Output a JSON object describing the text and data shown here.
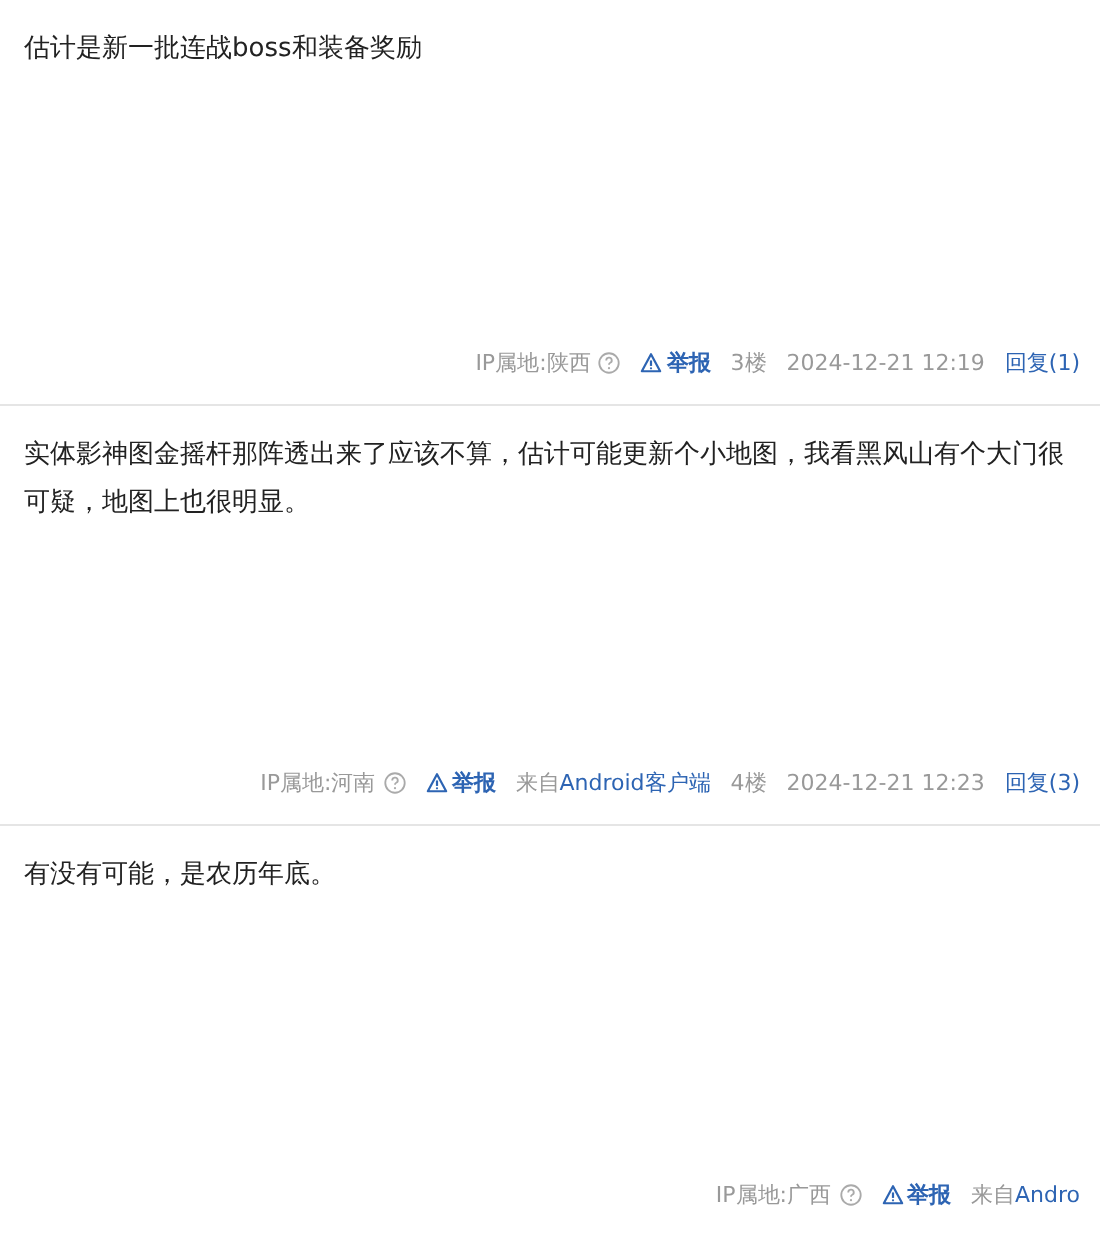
{
  "posts": [
    {
      "content": "估计是新一批连战boss和装备奖励",
      "ip": "IP属地:陕西",
      "report": "举报",
      "floor": "3楼",
      "time": "2024-12-21 12:19",
      "reply": "回复(1)"
    },
    {
      "content": "实体影神图金摇杆那阵透出来了应该不算，估计可能更新个小地图，我看黑风山有个大门很可疑，地图上也很明显。",
      "ip": "IP属地:河南",
      "report": "举报",
      "source_prefix": "来自",
      "source_app": "Android客户端",
      "floor": "4楼",
      "time": "2024-12-21 12:23",
      "reply": "回复(3)"
    },
    {
      "content": "有没有可能，是农历年底。",
      "ip": "IP属地:广西",
      "report": "举报",
      "source_prefix": "来自",
      "source_app": "Andro"
    }
  ]
}
